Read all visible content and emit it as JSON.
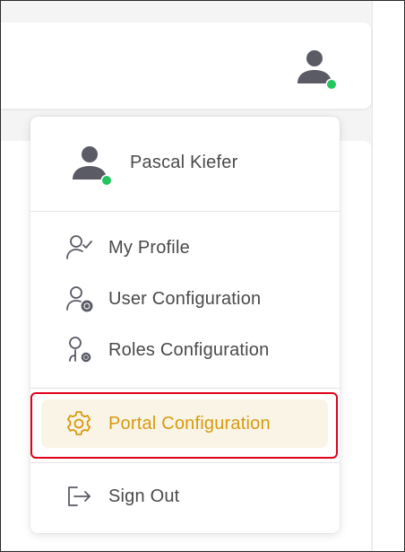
{
  "header": {
    "avatar_icon": "user-avatar-icon",
    "status": "online",
    "status_color": "#22c55e"
  },
  "menu": {
    "user_name": "Pascal Kiefer",
    "items": [
      {
        "label": "My Profile",
        "icon": "user-check-icon"
      },
      {
        "label": "User Configuration",
        "icon": "user-gear-icon"
      },
      {
        "label": "Roles Configuration",
        "icon": "user-small-gear-icon"
      },
      {
        "label": "Portal Configuration",
        "icon": "gear-icon",
        "active": true
      },
      {
        "label": "Sign Out",
        "icon": "sign-out-icon"
      }
    ]
  },
  "colors": {
    "text": "#4a4a4a",
    "icon": "#5a5a66",
    "accent": "#d79a0e",
    "active_bg": "#faf4e6",
    "highlight_border": "#e0001b"
  }
}
